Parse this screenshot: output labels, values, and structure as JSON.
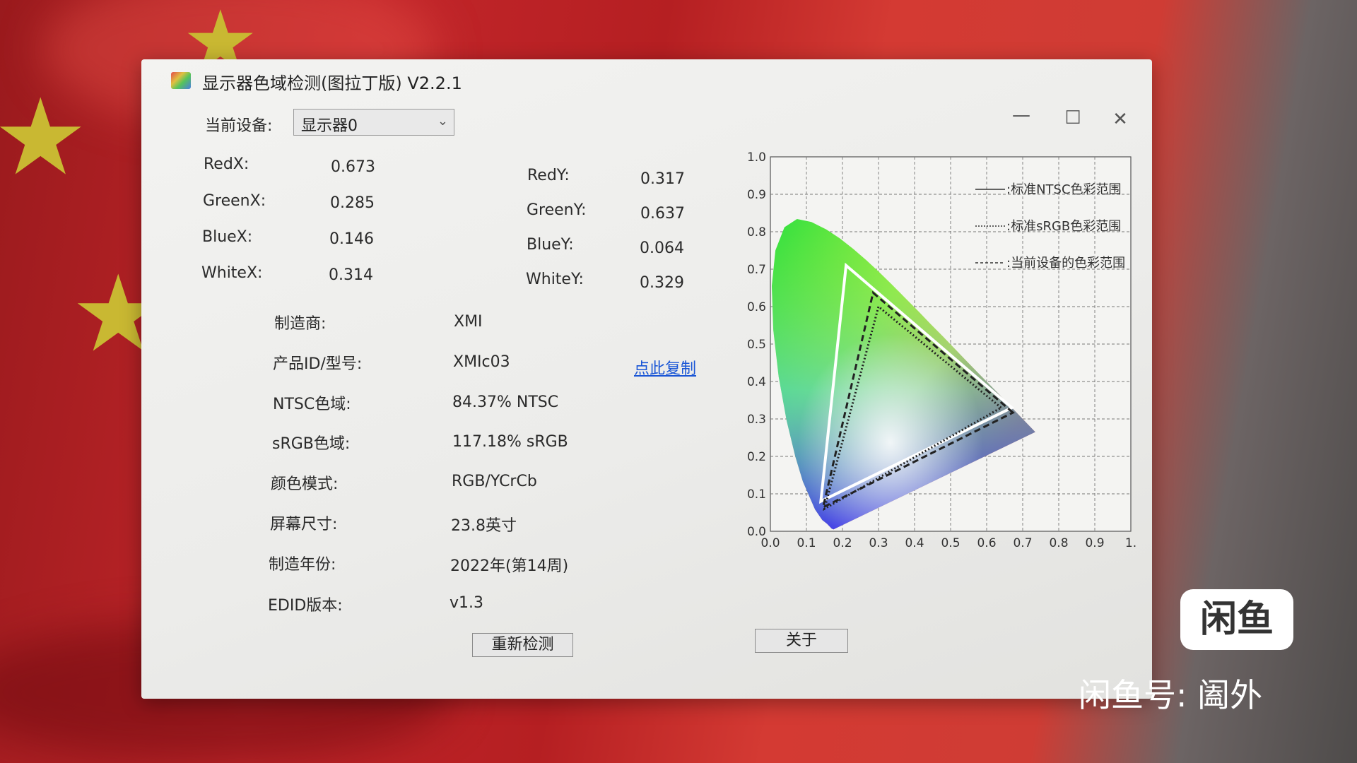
{
  "window": {
    "title": "显示器色域检测(图拉丁版) V2.2.1",
    "controls": {
      "minimize": "—",
      "maximize": "☐",
      "close": "✕"
    }
  },
  "device": {
    "label": "当前设备:",
    "selected": "显示器0"
  },
  "chromaticity": {
    "red_x_label": "RedX:",
    "red_x": "0.673",
    "green_x_label": "GreenX:",
    "green_x": "0.285",
    "blue_x_label": "BlueX:",
    "blue_x": "0.146",
    "white_x_label": "WhiteX:",
    "white_x": "0.314",
    "red_y_label": "RedY:",
    "red_y": "0.317",
    "green_y_label": "GreenY:",
    "green_y": "0.637",
    "blue_y_label": "BlueY:",
    "blue_y": "0.064",
    "white_y_label": "WhiteY:",
    "white_y": "0.329"
  },
  "info": {
    "manufacturer_label": "制造商:",
    "manufacturer": "XMI",
    "product_label": "产品ID/型号:",
    "product": "XMIc03",
    "copy_link": "点此复制",
    "ntsc_label": "NTSC色域:",
    "ntsc": "84.37% NTSC",
    "srgb_label": "sRGB色域:",
    "srgb": "117.18% sRGB",
    "color_mode_label": "颜色模式:",
    "color_mode": "RGB/YCrCb",
    "screen_size_label": "屏幕尺寸:",
    "screen_size": "23.8英寸",
    "year_label": "制造年份:",
    "year": "2022年(第14周)",
    "edid_label": "EDID版本:",
    "edid": "v1.3"
  },
  "buttons": {
    "redetect": "重新检测",
    "about": "关于"
  },
  "chart_data": {
    "type": "scatter",
    "x_ticks": [
      "0.0",
      "0.1",
      "0.2",
      "0.3",
      "0.4",
      "0.5",
      "0.6",
      "0.7",
      "0.8",
      "0.9",
      "1."
    ],
    "y_ticks": [
      "0.0",
      "0.1",
      "0.2",
      "0.3",
      "0.4",
      "0.5",
      "0.6",
      "0.7",
      "0.8",
      "0.9",
      "1.0"
    ],
    "xlim": [
      0,
      1
    ],
    "ylim": [
      0,
      1
    ],
    "grid": true,
    "legend_position": "top-right",
    "legend": [
      {
        "label": "标准NTSC色彩范围",
        "style": "solid"
      },
      {
        "label": "标准sRGB色彩范围",
        "style": "dotted"
      },
      {
        "label": "当前设备的色彩范围",
        "style": "dashed"
      }
    ],
    "series": [
      {
        "name": "标准NTSC色彩范围",
        "points": [
          [
            0.67,
            0.33
          ],
          [
            0.21,
            0.71
          ],
          [
            0.14,
            0.08
          ]
        ],
        "color": "#ffffff"
      },
      {
        "name": "标准sRGB色彩范围",
        "points": [
          [
            0.64,
            0.33
          ],
          [
            0.3,
            0.6
          ],
          [
            0.15,
            0.06
          ]
        ],
        "color": "#222222"
      },
      {
        "name": "当前设备的色彩范围",
        "points": [
          [
            0.673,
            0.317
          ],
          [
            0.285,
            0.637
          ],
          [
            0.146,
            0.064
          ]
        ],
        "color": "#222222"
      }
    ]
  },
  "watermark": {
    "logo": "闲鱼",
    "text": "闲鱼号: 阖外"
  }
}
